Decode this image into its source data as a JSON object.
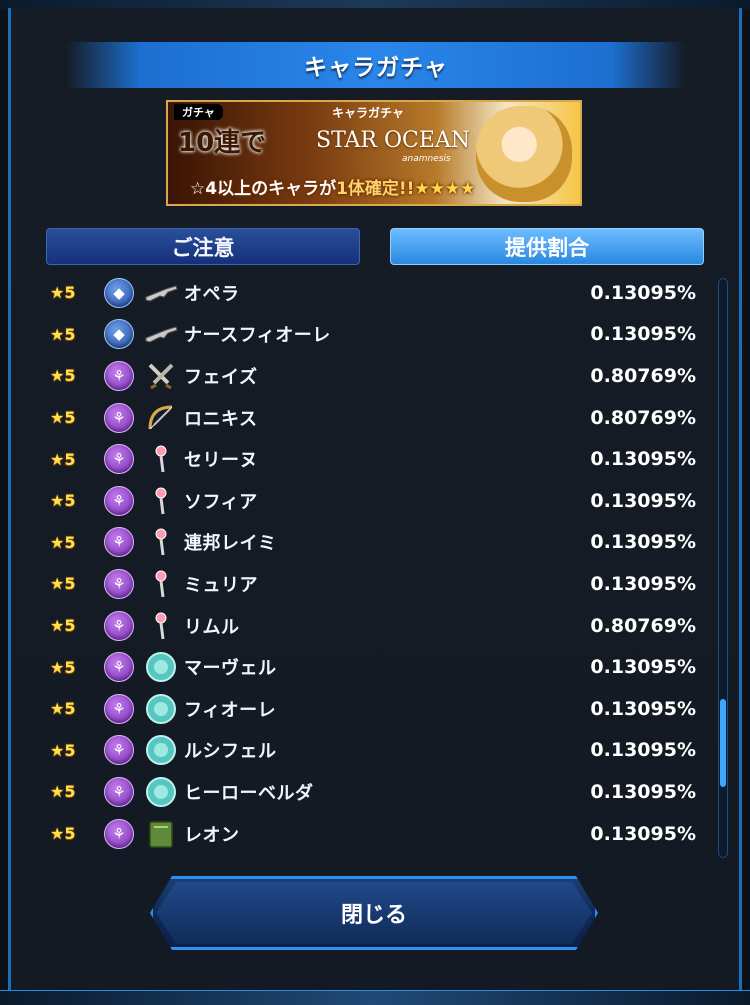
{
  "header": {
    "title": "キャラガチャ"
  },
  "banner": {
    "tag": "ガチャ",
    "gacha_title": "キャラガチャ",
    "ten_pull": "10連で",
    "logo": "STAR OCEAN",
    "logo_sub": "anamnesis",
    "message_pre": "☆4以上のキャラが",
    "message_bold": "1体確定!!",
    "stars": "★★★★"
  },
  "tabs": {
    "notice": "ご注意",
    "rates": "提供割合"
  },
  "colors": {
    "accent": "#2a86ea",
    "attack_role": "#1f4ea8",
    "support_role": "#7c2fbd",
    "rarity": "#ffe14a"
  },
  "rows": [
    {
      "rarity": "★5",
      "role": "attack",
      "weapon": "rifle-icon",
      "name": "オペラ",
      "rate": "0.13095%"
    },
    {
      "rarity": "★5",
      "role": "attack",
      "weapon": "rifle-icon",
      "name": "ナースフィオーレ",
      "rate": "0.13095%"
    },
    {
      "rarity": "★5",
      "role": "support",
      "weapon": "swords-icon",
      "name": "フェイズ",
      "rate": "0.80769%"
    },
    {
      "rarity": "★5",
      "role": "support",
      "weapon": "bow-icon",
      "name": "ロニキス",
      "rate": "0.80769%"
    },
    {
      "rarity": "★5",
      "role": "support",
      "weapon": "wand-icon",
      "name": "セリーヌ",
      "rate": "0.13095%"
    },
    {
      "rarity": "★5",
      "role": "support",
      "weapon": "wand-icon",
      "name": "ソフィア",
      "rate": "0.13095%"
    },
    {
      "rarity": "★5",
      "role": "support",
      "weapon": "wand-icon",
      "name": "連邦レイミ",
      "rate": "0.13095%"
    },
    {
      "rarity": "★5",
      "role": "support",
      "weapon": "wand-icon",
      "name": "ミュリア",
      "rate": "0.13095%"
    },
    {
      "rarity": "★5",
      "role": "support",
      "weapon": "wand-icon",
      "name": "リムル",
      "rate": "0.80769%"
    },
    {
      "rarity": "★5",
      "role": "support",
      "weapon": "orb-icon",
      "name": "マーヴェル",
      "rate": "0.13095%"
    },
    {
      "rarity": "★5",
      "role": "support",
      "weapon": "orb-icon",
      "name": "フィオーレ",
      "rate": "0.13095%"
    },
    {
      "rarity": "★5",
      "role": "support",
      "weapon": "orb-icon",
      "name": "ルシフェル",
      "rate": "0.13095%"
    },
    {
      "rarity": "★5",
      "role": "support",
      "weapon": "orb-icon",
      "name": "ヒーローベルダ",
      "rate": "0.13095%"
    },
    {
      "rarity": "★5",
      "role": "support",
      "weapon": "book-icon",
      "name": "レオン",
      "rate": "0.13095%"
    }
  ],
  "footer": {
    "close_label": "閉じる"
  }
}
